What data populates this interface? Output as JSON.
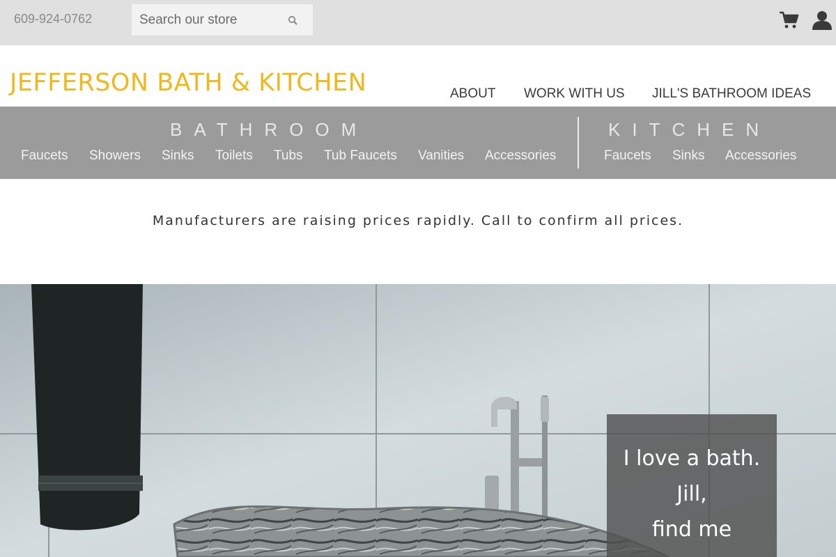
{
  "topbar": {
    "phone": "609-924-0762",
    "search_placeholder": "Search our store",
    "icons": {
      "search": "search-icon",
      "cart": "cart-icon",
      "account": "account-icon"
    }
  },
  "header": {
    "brand": "JEFFERSON BATH & KITCHEN",
    "brand_color": "#f1b81c",
    "nav": [
      "ABOUT",
      "WORK WITH US",
      "JILL'S BATHROOM IDEAS"
    ]
  },
  "categories": {
    "bathroom": {
      "title": "BATHROOM",
      "links": [
        "Faucets",
        "Showers",
        "Sinks",
        "Toilets",
        "Tubs",
        "Tub Faucets",
        "Vanities",
        "Accessories"
      ]
    },
    "kitchen": {
      "title": "KITCHEN",
      "links": [
        "Faucets",
        "Sinks",
        "Accessories"
      ]
    }
  },
  "announcement": "Manufacturers are raising prices rapidly. Call to confirm all prices.",
  "hero": {
    "quote_lines": [
      "I love a bath.",
      "Jill,",
      "find me"
    ]
  }
}
